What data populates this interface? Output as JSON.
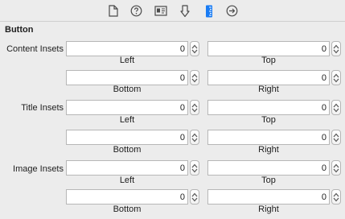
{
  "toolbar": {
    "icons": [
      {
        "name": "file-inspector-icon",
        "selected": false
      },
      {
        "name": "quick-help-icon",
        "selected": false
      },
      {
        "name": "identity-inspector-icon",
        "selected": false
      },
      {
        "name": "attributes-inspector-icon",
        "selected": false
      },
      {
        "name": "size-inspector-icon",
        "selected": true
      },
      {
        "name": "connections-inspector-icon",
        "selected": false
      }
    ],
    "accent": "#1a7cf4"
  },
  "section": {
    "title": "Button"
  },
  "groups": [
    {
      "label": "Content Insets",
      "left": "0",
      "top": "0",
      "bottom": "0",
      "right": "0",
      "captions": {
        "left": "Left",
        "top": "Top",
        "bottom": "Bottom",
        "right": "Right"
      }
    },
    {
      "label": "Title Insets",
      "left": "0",
      "top": "0",
      "bottom": "0",
      "right": "0",
      "captions": {
        "left": "Left",
        "top": "Top",
        "bottom": "Bottom",
        "right": "Right"
      }
    },
    {
      "label": "Image Insets",
      "left": "0",
      "top": "0",
      "bottom": "0",
      "right": "0",
      "captions": {
        "left": "Left",
        "top": "Top",
        "bottom": "Bottom",
        "right": "Right"
      }
    }
  ]
}
